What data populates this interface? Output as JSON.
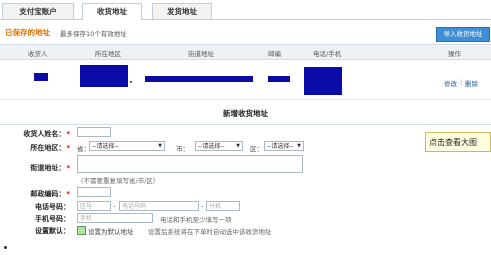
{
  "tabs": [
    {
      "label": "支付宝账户",
      "active": false
    },
    {
      "label": "收货地址",
      "active": true
    },
    {
      "label": "发货地址",
      "active": false
    }
  ],
  "saved": {
    "title": "已保存的地址",
    "hint": "最多保存10个有效地址",
    "import_button": "导入收货地址"
  },
  "table": {
    "headers": [
      "收货人",
      "所在地区",
      "街道地址",
      "邮编",
      "电话/手机",
      "操作"
    ],
    "row_actions": {
      "edit": "修改",
      "separator": "|",
      "delete": "删除"
    }
  },
  "new_address": {
    "title": "新增收货地址",
    "fields": {
      "name_label": "收货人姓名：",
      "region_label": "所在地区：",
      "province_label": "省：",
      "province_select": "--请选择--",
      "city_label": "市：",
      "city_select": "--请选择--",
      "district_label": "区：",
      "district_select": "--请选择--",
      "street_label": "街道地址：",
      "street_hint": "（不需要重复填写省/市/区）",
      "zip_label": "邮政编码：",
      "phone_label": "电话号码：",
      "phone_area_placeholder": "区号",
      "phone_number_placeholder": "电话号码",
      "phone_ext_placeholder": "分机",
      "mobile_label": "手机号码：",
      "mobile_placeholder": "手机",
      "mobile_hint": "电话和手机至少填写一项",
      "default_label": "设置默认：",
      "default_checkbox_text": "设置为默认地址",
      "default_hint": "设置后系统将在下单时自动选中该收货地址"
    },
    "required_mark": "*"
  },
  "tooltip": {
    "text": "点击查看大图"
  },
  "colors": {
    "accent_orange": "#e07000",
    "import_button": "#3d8fd8",
    "link": "#1a57a8",
    "redaction": "#0b0ba8"
  }
}
